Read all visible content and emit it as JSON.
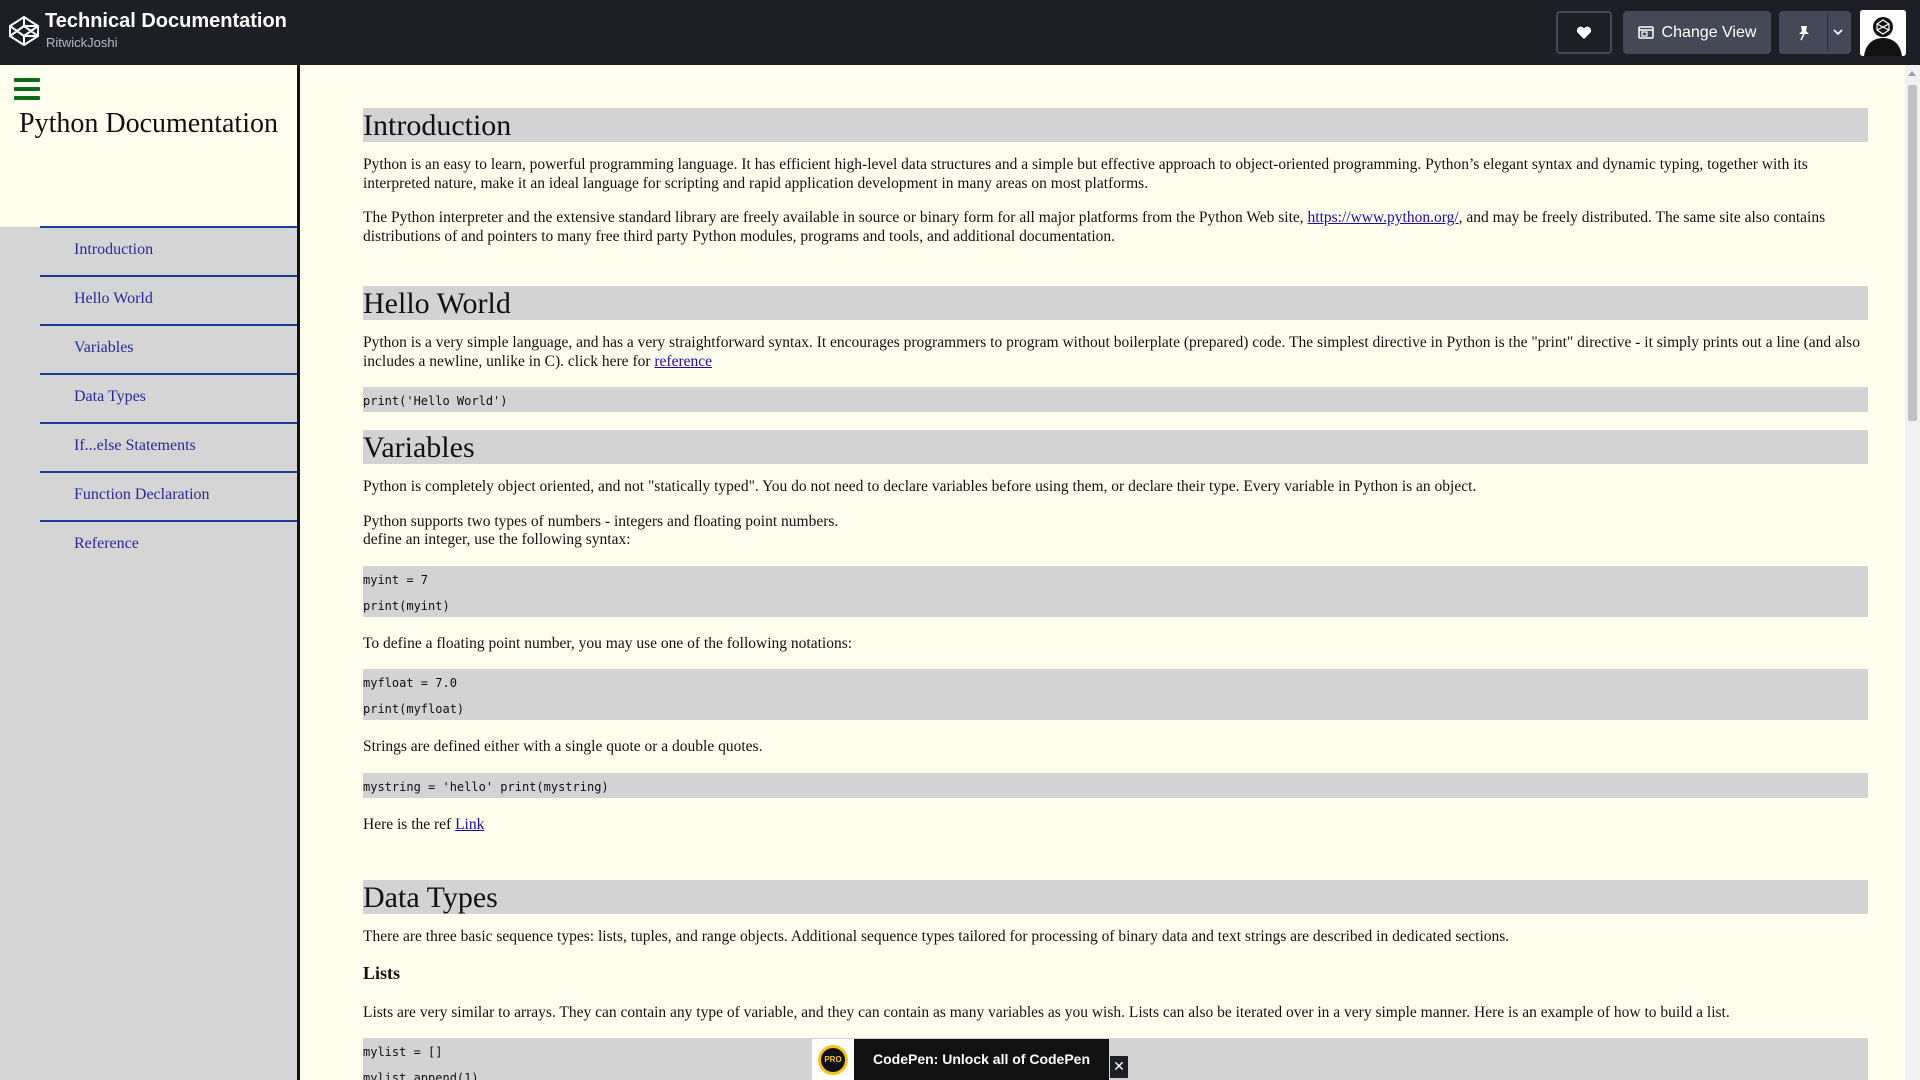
{
  "codepen": {
    "title": "Technical Documentation",
    "author": "RitwickJoshi",
    "change_view_label": "Change View",
    "icons": {
      "logo": "codepen-logo-icon",
      "heart": "heart-icon",
      "view": "change-view-icon",
      "pin": "pin-icon",
      "caret": "chevron-down-icon"
    }
  },
  "sidebar": {
    "title": "Python Documentation",
    "items": [
      {
        "label": "Introduction"
      },
      {
        "label": "Hello World"
      },
      {
        "label": "Variables"
      },
      {
        "label": "Data Types"
      },
      {
        "label": "If...else Statements"
      },
      {
        "label": "Function Declaration"
      },
      {
        "label": "Reference"
      }
    ]
  },
  "main": {
    "intro": {
      "heading": "Introduction",
      "p1": "Python is an easy to learn, powerful programming language. It has efficient high-level data structures and a simple but effective approach to object-oriented programming. Python’s elegant syntax and dynamic typing, together with its interpreted nature, make it an ideal language for scripting and rapid application development in many areas on most platforms.",
      "p2_before": "The Python interpreter and the extensive standard library are freely available in source or binary form for all major platforms from the Python Web site, ",
      "p2_link": "https://www.python.org/",
      "p2_after": ", and may be freely distributed. The same site also contains distributions of and pointers to many free third party Python modules, programs and tools, and additional documentation."
    },
    "hello": {
      "heading": "Hello World",
      "p1_before": "Python is a very simple language, and has a very straightforward syntax. It encourages programmers to program without boilerplate (prepared) code. The simplest directive in Python is the \"print\" directive - it simply prints out a line (and also includes a newline, unlike in C). click here for ",
      "p1_link": "reference",
      "code": "print('Hello World')"
    },
    "variables": {
      "heading": "Variables",
      "p1": "Python is completely object oriented, and not \"statically typed\". You do not need to declare variables before using them, or declare their type. Every variable in Python is an object.",
      "p2_line1": "Python supports two types of numbers - integers and floating point numbers.",
      "p2_line2": "define an integer, use the following syntax:",
      "code1_line1": "myint = 7",
      "code1_line2": "print(myint)",
      "p3": "To define a floating point number, you may use one of the following notations:",
      "code2_line1": "myfloat = 7.0",
      "code2_line2": "print(myfloat)",
      "p4": "Strings are defined either with a single quote or a double quotes.",
      "code3": "mystring = 'hello' print(mystring)",
      "p5_before": "Here is the ref ",
      "p5_link": "Link"
    },
    "datatypes": {
      "heading": "Data Types",
      "p1": "There are three basic sequence types: lists, tuples, and range objects. Additional sequence types tailored for processing of binary data and text strings are described in dedicated sections.",
      "subheading": "Lists",
      "p2": "Lists are very similar to arrays. They can contain any type of variable, and they can contain as many variables as you wish. Lists can also be iterated over in a very simple manner. Here is an example of how to build a list.",
      "code_line1": "mylist = []",
      "code_line2": "mylist.append(1)"
    }
  },
  "pro_banner": {
    "badge": "PRO",
    "text": "CodePen: Unlock all of CodePen",
    "close": "✕"
  },
  "colors": {
    "topbar": "#1e1f26",
    "page_bg": "#fffff0",
    "sidebar_bg": "#d5d5d5",
    "nav_border": "#1f3b8f",
    "hamburger": "#0c6b18",
    "section_bg": "#d3d3d3"
  }
}
